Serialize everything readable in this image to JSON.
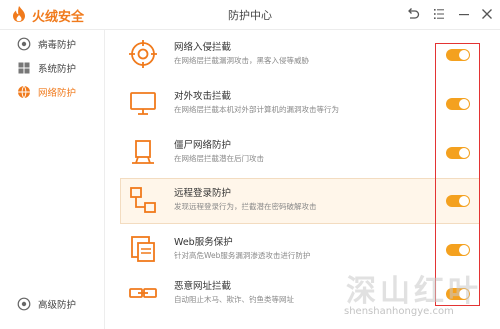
{
  "app": {
    "brand": "火绒安全",
    "window_title": "防护中心"
  },
  "window_controls": [
    {
      "icon": "back-icon"
    },
    {
      "icon": "menu-icon"
    },
    {
      "icon": "minimize-icon"
    },
    {
      "icon": "close-icon"
    }
  ],
  "sidebar": {
    "items": [
      {
        "label": "病毒防护",
        "icon": "virus-shield-icon",
        "active": false
      },
      {
        "label": "系统防护",
        "icon": "windows-icon",
        "active": false
      },
      {
        "label": "网络防护",
        "icon": "globe-icon",
        "active": true
      }
    ],
    "bottom_item": {
      "label": "高级防护",
      "icon": "advanced-shield-icon"
    }
  },
  "features": [
    {
      "title": "网络入侵拦截",
      "desc": "在网络层拦截漏洞攻击，黑客入侵等威胁",
      "icon": "target-icon",
      "enabled": true
    },
    {
      "title": "对外攻击拦截",
      "desc": "在网络层拦截本机对外部计算机的漏洞攻击等行为",
      "icon": "monitor-icon",
      "enabled": true
    },
    {
      "title": "僵尸网络防护",
      "desc": "在网络层拦截潜在后门攻击",
      "icon": "botnet-icon",
      "enabled": true
    },
    {
      "title": "远程登录防护",
      "desc": "发现远程登录行为，拦截潜在密码破解攻击",
      "icon": "remote-login-icon",
      "enabled": true
    },
    {
      "title": "Web服务保护",
      "desc": "针对高危Web服务漏洞渗透攻击进行防护",
      "icon": "web-service-icon",
      "enabled": true
    },
    {
      "title": "恶意网址拦截",
      "desc": "自动阻止木马、欺诈、钓鱼类等网址",
      "icon": "link-icon",
      "enabled": true
    }
  ],
  "watermark": {
    "text": "深山红叶",
    "url": "shenshanhongye.com"
  },
  "colors": {
    "accent": "#f07a1c",
    "toggle_on": "#f4a11f",
    "highlight_bg": "#fff6ea",
    "annotation_red": "#e33333"
  }
}
